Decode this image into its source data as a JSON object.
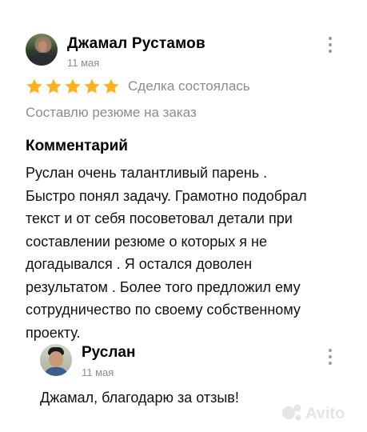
{
  "review": {
    "author": "Джамал Рустамов",
    "date": "11 мая",
    "rating": 5,
    "rating_max": 5,
    "status": "Сделка состоялась",
    "service": "Составлю резюме на заказ",
    "comment_title": "Комментарий",
    "comment_text": "Руслан очень талантливый парень .\nБыстро понял задачу.  Грамотно подобрал\nтекст и от себя посоветовал детали при\nсоставлении резюме о которых я не\nдогадывался . Я остался доволен\nрезультатом . Более того  предложил ему\nсотрудничество по своему собственному\nпроекту."
  },
  "reply": {
    "author": "Руслан",
    "date": "11 мая",
    "text": "Джамал, благодарю за отзыв!"
  },
  "colors": {
    "star": "#FFB021",
    "muted_text": "#8C8C8C",
    "primary_text": "#000000"
  },
  "icons": {
    "more": "more-vertical-icon",
    "star": "star-icon",
    "watermark": "avito-logo"
  },
  "watermark_text": "Avito"
}
